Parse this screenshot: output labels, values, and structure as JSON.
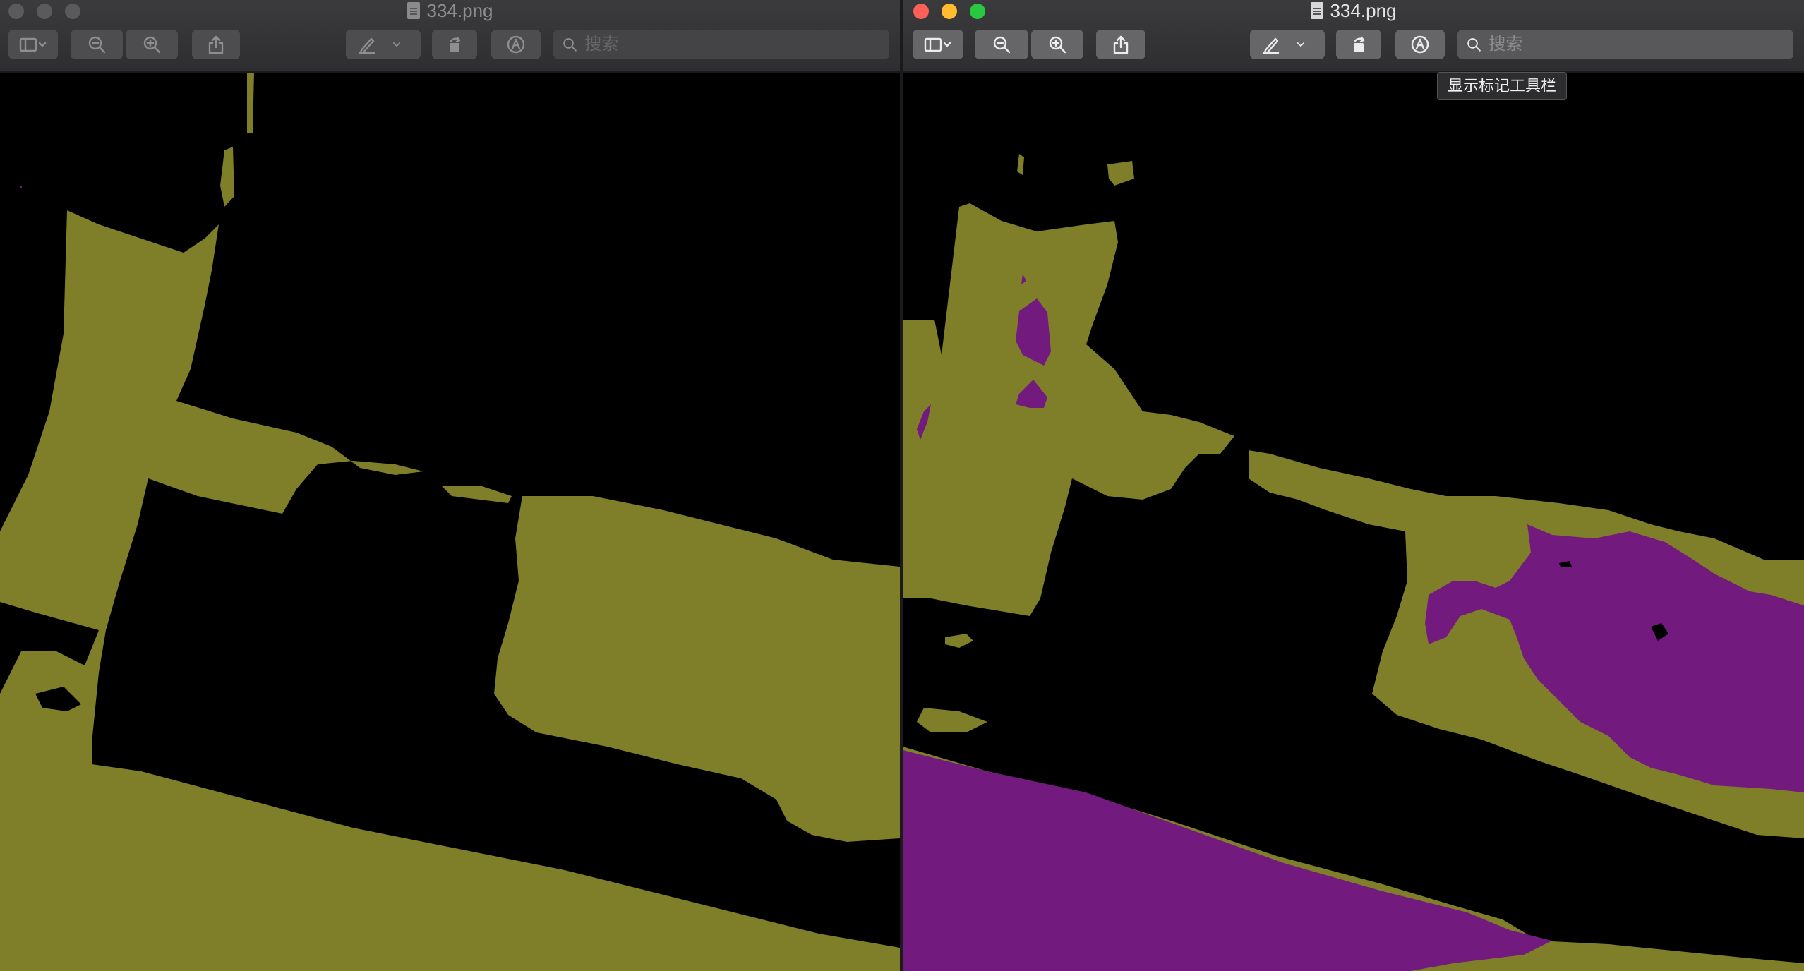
{
  "left_window": {
    "title": "334.png",
    "search_placeholder": "搜索"
  },
  "right_window": {
    "title": "334.png",
    "search_placeholder": "搜索"
  },
  "tooltip": {
    "text": "显示标记工具栏"
  },
  "colors": {
    "foreground_region": "#7f7f2a",
    "secondary_region": "#731a7e",
    "background": "#000000"
  },
  "icons": [
    "sidebar-icon",
    "chevron-down-icon",
    "zoom-out-icon",
    "zoom-in-icon",
    "share-icon",
    "pen-icon",
    "rotate-icon",
    "markup-icon",
    "search-icon",
    "document-icon"
  ]
}
